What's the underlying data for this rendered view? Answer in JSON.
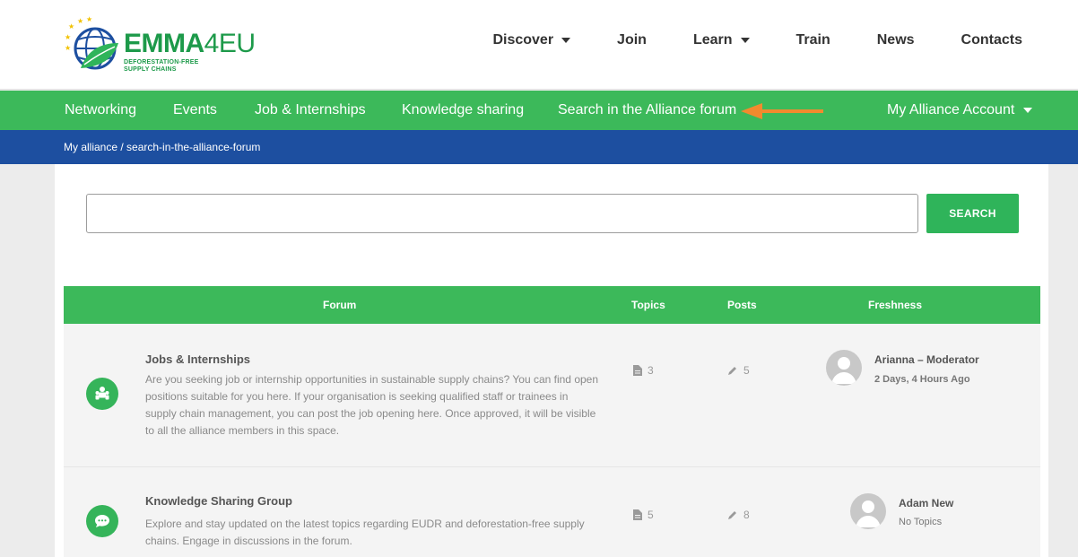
{
  "brand": {
    "name_main": "EMMA",
    "name_suffix": "4EU",
    "tagline_line1": "DEFORESTATION-FREE",
    "tagline_line2": "SUPPLY CHAINS"
  },
  "topnav": [
    {
      "label": "Discover",
      "dropdown": true
    },
    {
      "label": "Join",
      "dropdown": false
    },
    {
      "label": "Learn",
      "dropdown": true
    },
    {
      "label": "Train",
      "dropdown": false
    },
    {
      "label": "News",
      "dropdown": false
    },
    {
      "label": "Contacts",
      "dropdown": false
    }
  ],
  "subnav": {
    "networking": "Networking",
    "events": "Events",
    "jobs": "Job & Internships",
    "knowledge": "Knowledge sharing",
    "search_forum": "Search in the Alliance forum",
    "account": "My Alliance Account"
  },
  "breadcrumb": "My alliance / search-in-the-alliance-forum",
  "search": {
    "placeholder": "",
    "button_label": "SEARCH"
  },
  "table": {
    "headers": {
      "forum": "Forum",
      "topics": "Topics",
      "posts": "Posts",
      "freshness": "Freshness"
    },
    "rows": [
      {
        "title": "Jobs & Internships",
        "description": "Are you seeking job or internship opportunities in sustainable supply chains? You can find open positions suitable for you here. If your organisation is seeking qualified staff or trainees in supply chain management, you can post the job opening here. Once approved, it will be visible to all the alliance members in this space.",
        "topics": "3",
        "posts": "5",
        "fresh_name": "Arianna – Moderator",
        "fresh_time": "2 Days, 4 Hours Ago",
        "icon": "people-icon"
      },
      {
        "title": "Knowledge Sharing Group",
        "description": "Explore and stay updated on the latest topics regarding EUDR and deforestation-free supply chains. Engage in discussions in the forum.",
        "topics": "5",
        "posts": "8",
        "fresh_name": "Adam New",
        "fresh_time": "No Topics",
        "icon": "chat-bubble-icon"
      }
    ]
  },
  "colors": {
    "green": "#3cb95a",
    "blue": "#1d4fa0",
    "arrow": "#f28a2e"
  }
}
